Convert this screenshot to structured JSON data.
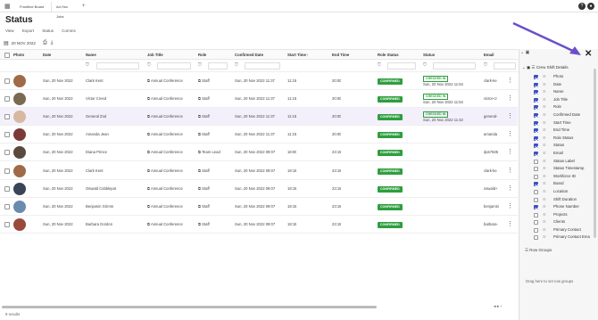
{
  "tabs": [
    {
      "label": "Frontline Board"
    },
    {
      "label": "Ad Hoc Jobs"
    }
  ],
  "page_title": "Status",
  "menu": [
    "View",
    "Export",
    "Status",
    "Comms"
  ],
  "date": "20 NOV 2022",
  "columns": [
    "Photo",
    "Date",
    "Name",
    "Job Title",
    "Role",
    "Confirmed Date",
    "Start Time",
    "End Time",
    "Role Status",
    "Status",
    "Email"
  ],
  "rows": [
    {
      "date": "Sun, 20 Nov 2022",
      "name": "Clark Kent",
      "job": "Annual Conference",
      "role": "Staff",
      "confirmed": "Sun, 20 Nov 2022 11:37",
      "start": "11:15",
      "end": "20:00",
      "role_status": "CONFIRMED",
      "status": "CHECKED IN",
      "status_time": "Sun, 20 Nov 2022 11:54",
      "email": "clark-ke",
      "avatar": "#a06a48"
    },
    {
      "date": "Sun, 20 Nov 2022",
      "name": "Victor Creed",
      "job": "Annual Conference",
      "role": "Staff",
      "confirmed": "Sun, 20 Nov 2022 11:37",
      "start": "11:15",
      "end": "20:00",
      "role_status": "CONFIRMED",
      "status": "CHECKED IN",
      "status_time": "Sun, 20 Nov 2022 11:54",
      "email": "victor-cr",
      "avatar": "#7a6a52"
    },
    {
      "date": "Sun, 20 Nov 2022",
      "name": "General Zod",
      "job": "Annual Conference",
      "role": "Staff",
      "confirmed": "Sun, 20 Nov 2022 11:37",
      "start": "11:15",
      "end": "20:00",
      "role_status": "CONFIRMED",
      "status": "CHECKED IN",
      "status_time": "Sun, 20 Nov 2022 11:42",
      "email": "general-",
      "avatar": "#d7b8a0"
    },
    {
      "date": "Sun, 20 Nov 2022",
      "name": "Amanda Jean",
      "job": "Annual Conference",
      "role": "Staff",
      "confirmed": "Sun, 20 Nov 2022 11:37",
      "start": "11:15",
      "end": "20:00",
      "role_status": "CONFIRMED",
      "status": "",
      "status_time": "",
      "email": "amanda",
      "avatar": "#7a3a38"
    },
    {
      "date": "Sun, 20 Nov 2022",
      "name": "Diana Prince",
      "job": "Annual Conference",
      "role": "Team Lead",
      "confirmed": "Sun, 20 Nov 2022 09:07",
      "start": "18:00",
      "end": "23:15",
      "role_status": "CONFIRMED",
      "status": "",
      "status_time": "",
      "email": "dps7635",
      "avatar": "#5a4a3e"
    },
    {
      "date": "Sun, 20 Nov 2022",
      "name": "Clark Kent",
      "job": "Annual Conference",
      "role": "Staff",
      "confirmed": "Sun, 20 Nov 2022 09:07",
      "start": "18:15",
      "end": "23:15",
      "role_status": "CONFIRMED",
      "status": "",
      "status_time": "",
      "email": "clark-ke",
      "avatar": "#a06a48"
    },
    {
      "date": "Sun, 20 Nov 2022",
      "name": "Oswald Cobblepot",
      "job": "Annual Conference",
      "role": "Staff",
      "confirmed": "Sun, 20 Nov 2022 09:07",
      "start": "18:15",
      "end": "23:15",
      "role_status": "CONFIRMED",
      "status": "",
      "status_time": "",
      "email": "oswald+",
      "avatar": "#3a4658"
    },
    {
      "date": "Sun, 20 Nov 2022",
      "name": "Benjamin Grimm",
      "job": "Annual Conference",
      "role": "Staff",
      "confirmed": "Sun, 20 Nov 2022 09:07",
      "start": "18:15",
      "end": "23:15",
      "role_status": "CONFIRMED",
      "status": "",
      "status_time": "",
      "email": "benjamin",
      "avatar": "#6a8ab0"
    },
    {
      "date": "Sun, 20 Nov 2022",
      "name": "Barbara Gordon",
      "job": "Annual Conference",
      "role": "Staff",
      "confirmed": "Sun, 20 Nov 2022 09:07",
      "start": "18:15",
      "end": "23:15",
      "role_status": "CONFIRMED",
      "status": "",
      "status_time": "",
      "email": "barbara-",
      "avatar": "#9a4a3a"
    }
  ],
  "results": "9 results",
  "panel": {
    "group": "Crew Shift Details",
    "items": [
      {
        "label": "Photo",
        "checked": true
      },
      {
        "label": "Date",
        "checked": true
      },
      {
        "label": "Name",
        "checked": true
      },
      {
        "label": "Job Title",
        "checked": true
      },
      {
        "label": "Role",
        "checked": true
      },
      {
        "label": "Confirmed Date",
        "checked": true
      },
      {
        "label": "Start Time",
        "checked": true
      },
      {
        "label": "End Time",
        "checked": true
      },
      {
        "label": "Role Status",
        "checked": true
      },
      {
        "label": "Status",
        "checked": true
      },
      {
        "label": "Email",
        "checked": true
      },
      {
        "label": "Status Label",
        "checked": false
      },
      {
        "label": "Status Timestamp",
        "checked": false
      },
      {
        "label": "Workforce ID",
        "checked": false
      },
      {
        "label": "Board",
        "checked": true
      },
      {
        "label": "Location",
        "checked": false
      },
      {
        "label": "Shift Duration",
        "checked": false
      },
      {
        "label": "Phone Number",
        "checked": true
      },
      {
        "label": "Projects",
        "checked": false
      },
      {
        "label": "Clients",
        "checked": false
      },
      {
        "label": "Primary Contact",
        "checked": false
      },
      {
        "label": "Primary Contact Ema",
        "checked": false
      }
    ],
    "row_groups": "Row Groups",
    "drop_hint": "Drag here to set row groups"
  },
  "colors": {
    "accent": "#3b4fc4",
    "confirmed": "#2e9e3e",
    "arrow": "#6a4fc8"
  },
  "icons": [
    "grid-icon",
    "calendar-icon",
    "print-icon",
    "download-icon",
    "filter-icon",
    "external-link-icon",
    "kebab-icon",
    "close-icon",
    "help-icon",
    "user-icon",
    "chevron-down-icon",
    "drag-handle-icon"
  ]
}
